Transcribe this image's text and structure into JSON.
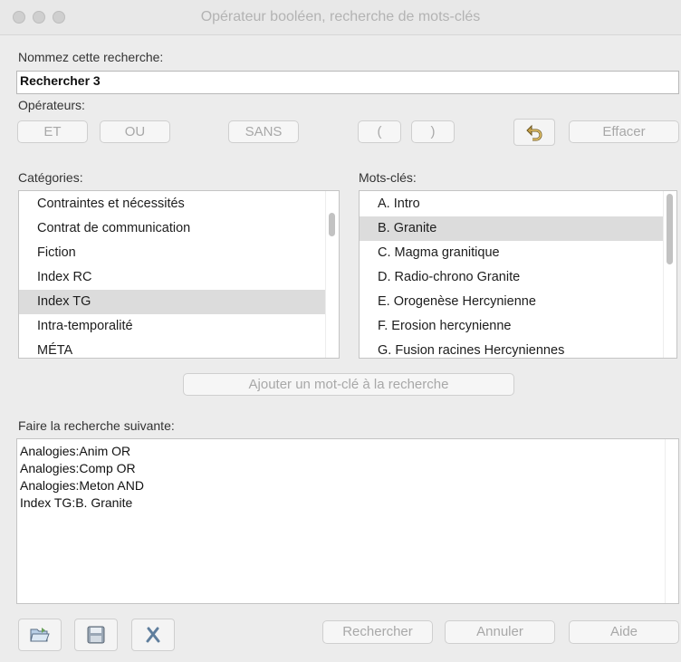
{
  "window": {
    "title": "Opérateur booléen, recherche de mots-clés"
  },
  "name_section": {
    "label": "Nommez cette recherche:",
    "value": "Rechercher 3"
  },
  "operators": {
    "label": "Opérateurs:",
    "and": "ET",
    "or": "OU",
    "not": "SANS",
    "open_paren": "(",
    "close_paren": ")",
    "undo_icon": "undo-arrow-icon",
    "clear": "Effacer"
  },
  "categories": {
    "label": "Catégories:",
    "items": [
      "Contraintes et nécessités",
      "Contrat de communication",
      "Fiction",
      "Index RC",
      "Index TG",
      "Intra-temporalité",
      "MÉTA"
    ],
    "selected": "Index TG"
  },
  "keywords": {
    "label": "Mots-clés:",
    "items": [
      "A. Intro",
      "B. Granite",
      "C. Magma granitique",
      "D. Radio-chrono Granite",
      "E. Orogenèse Hercynienne",
      "F. Erosion hercynienne",
      "G. Fusion racines Hercyniennes"
    ],
    "selected": "B. Granite"
  },
  "add_keyword_button": "Ajouter un mot-clé à la recherche",
  "query": {
    "label": "Faire la recherche suivante:",
    "lines": [
      "Analogies:Anim OR",
      "Analogies:Comp OR",
      "Analogies:Meton AND",
      "Index TG:B. Granite"
    ]
  },
  "footer": {
    "open_icon": "open-folder-icon",
    "save_icon": "floppy-disk-icon",
    "clear_icon": "x-delete-icon",
    "search": "Rechercher",
    "cancel": "Annuler",
    "help": "Aide"
  }
}
